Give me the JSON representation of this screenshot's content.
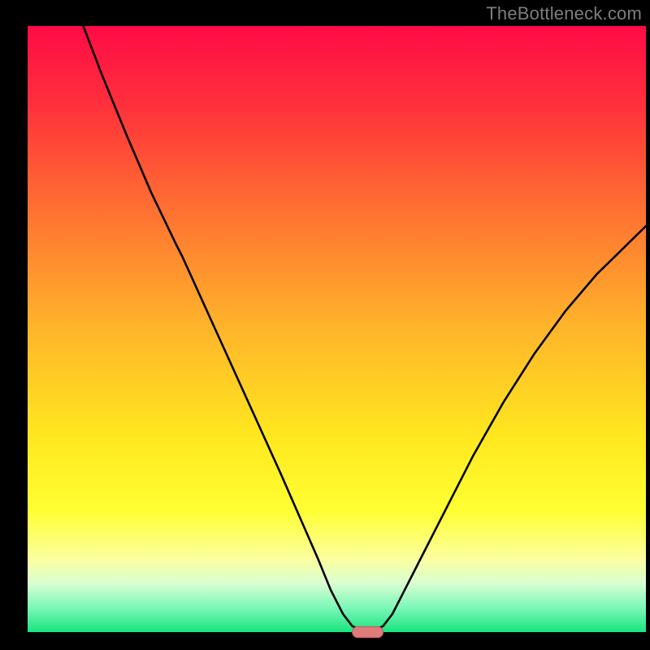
{
  "watermark": "TheBottleneck.com",
  "chart_data": {
    "type": "line",
    "title": "",
    "xlabel": "",
    "ylabel": "",
    "xlim": [
      0,
      100
    ],
    "ylim": [
      0,
      100
    ],
    "background_gradient": {
      "stops": [
        {
          "offset": 0.0,
          "color": "#ff0b47"
        },
        {
          "offset": 0.12,
          "color": "#ff2d3c"
        },
        {
          "offset": 0.3,
          "color": "#ff6f32"
        },
        {
          "offset": 0.5,
          "color": "#ffb52a"
        },
        {
          "offset": 0.68,
          "color": "#ffe81f"
        },
        {
          "offset": 0.8,
          "color": "#ffff33"
        },
        {
          "offset": 0.88,
          "color": "#fbffa0"
        },
        {
          "offset": 0.92,
          "color": "#d8ffd2"
        },
        {
          "offset": 0.96,
          "color": "#7bf7b7"
        },
        {
          "offset": 1.0,
          "color": "#18e47e"
        }
      ]
    },
    "series": [
      {
        "name": "bottleneck-curve",
        "color": "#000000",
        "stroke_width": 2.6,
        "points": [
          {
            "x": 9.0,
            "y": 100.0
          },
          {
            "x": 12.0,
            "y": 92.0
          },
          {
            "x": 16.0,
            "y": 82.0
          },
          {
            "x": 20.0,
            "y": 72.5
          },
          {
            "x": 24.0,
            "y": 64.0
          },
          {
            "x": 25.0,
            "y": 62.0
          },
          {
            "x": 29.0,
            "y": 53.0
          },
          {
            "x": 33.0,
            "y": 44.0
          },
          {
            "x": 37.0,
            "y": 35.0
          },
          {
            "x": 41.0,
            "y": 26.0
          },
          {
            "x": 44.0,
            "y": 19.0
          },
          {
            "x": 47.0,
            "y": 12.0
          },
          {
            "x": 49.0,
            "y": 7.0
          },
          {
            "x": 51.0,
            "y": 3.0
          },
          {
            "x": 52.5,
            "y": 1.0
          },
          {
            "x": 54.0,
            "y": 0.3
          },
          {
            "x": 56.0,
            "y": 0.3
          },
          {
            "x": 57.5,
            "y": 1.0
          },
          {
            "x": 59.0,
            "y": 3.0
          },
          {
            "x": 61.0,
            "y": 7.0
          },
          {
            "x": 64.0,
            "y": 13.0
          },
          {
            "x": 68.0,
            "y": 21.0
          },
          {
            "x": 72.0,
            "y": 29.0
          },
          {
            "x": 77.0,
            "y": 38.0
          },
          {
            "x": 82.0,
            "y": 46.0
          },
          {
            "x": 87.0,
            "y": 53.0
          },
          {
            "x": 92.0,
            "y": 59.0
          },
          {
            "x": 97.0,
            "y": 64.0
          },
          {
            "x": 100.0,
            "y": 67.0
          }
        ]
      }
    ],
    "marker": {
      "name": "optimal-point",
      "shape": "rounded-rect",
      "x": 55.0,
      "y": 0.0,
      "width": 5.0,
      "height": 1.8,
      "fill": "#e07b7b",
      "stroke": "#b55a5a"
    },
    "frame": {
      "left_border": 34,
      "right_border": 5,
      "top_border": 32,
      "bottom_border": 22,
      "border_color": "#000000"
    }
  }
}
